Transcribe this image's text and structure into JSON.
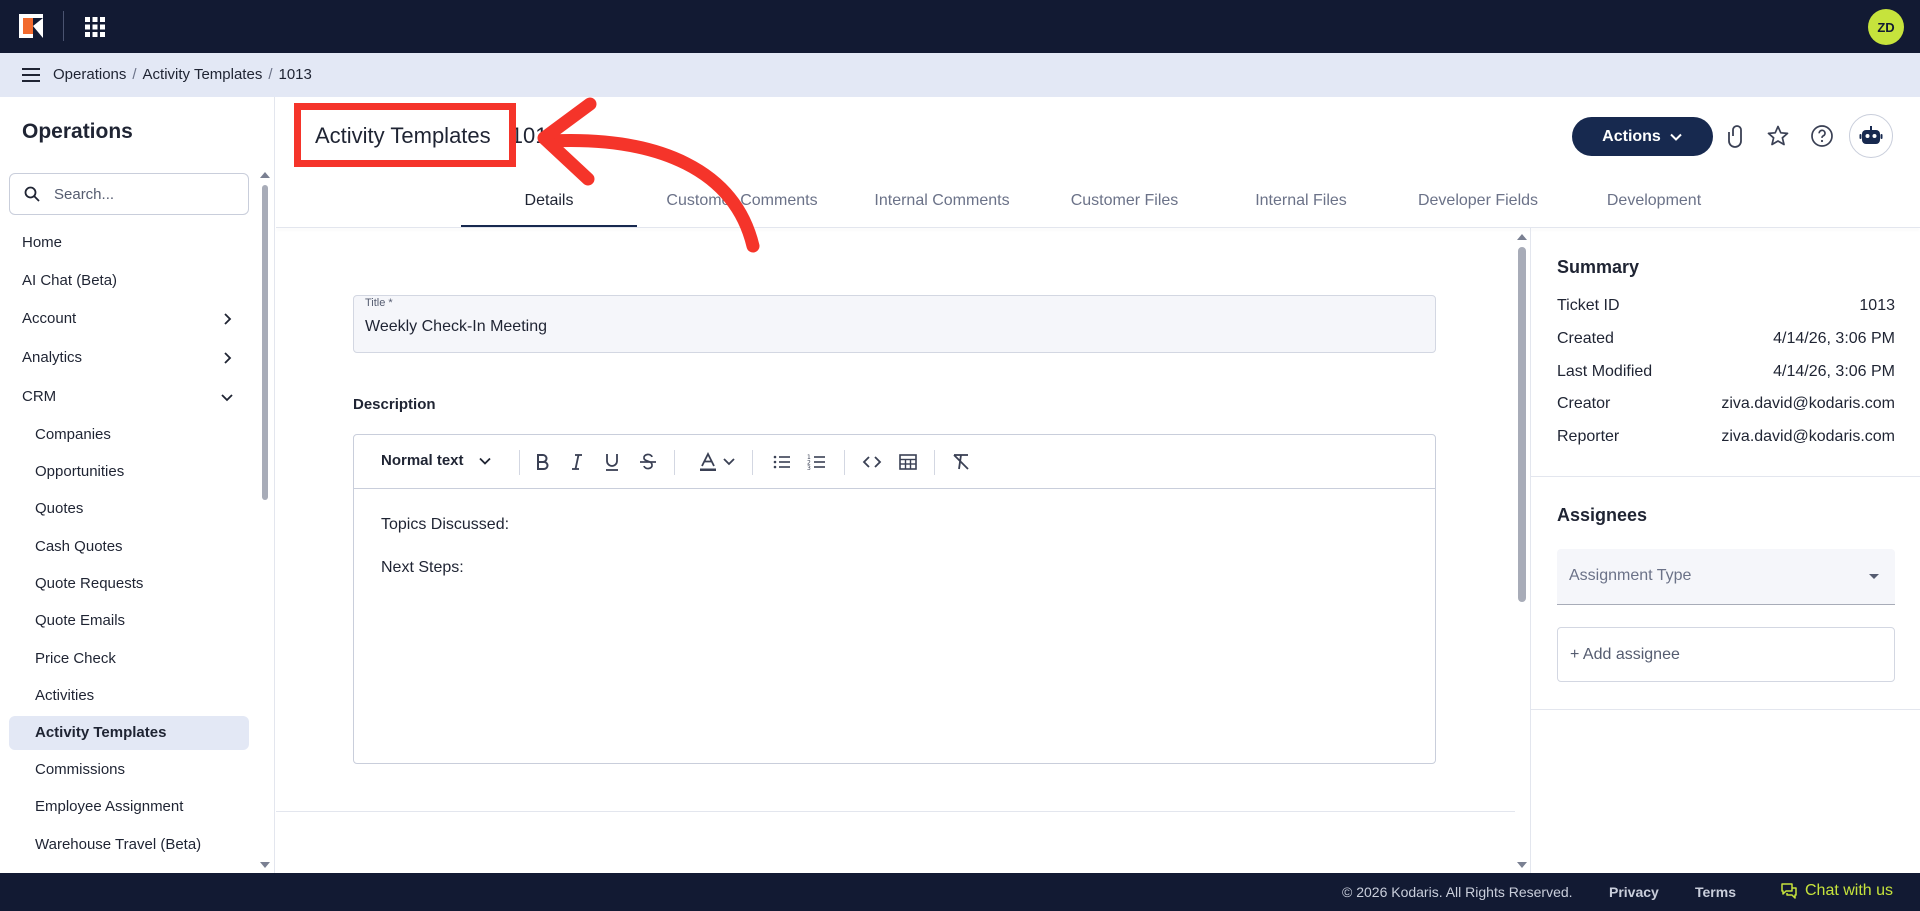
{
  "topbar": {
    "avatar_initials": "ZD"
  },
  "breadcrumb": {
    "items": [
      "Operations",
      "Activity Templates",
      "1013"
    ],
    "separator": "/"
  },
  "sidebar": {
    "title": "Operations",
    "search_placeholder": "Search...",
    "items": [
      {
        "label": "Home"
      },
      {
        "label": "AI Chat (Beta)"
      },
      {
        "label": "Account",
        "expandable": true,
        "expanded": false
      },
      {
        "label": "Analytics",
        "expandable": true,
        "expanded": false
      },
      {
        "label": "CRM",
        "expandable": true,
        "expanded": true
      }
    ],
    "crm_children": [
      "Companies",
      "Opportunities",
      "Quotes",
      "Cash Quotes",
      "Quote Requests",
      "Quote Emails",
      "Price Check",
      "Activities",
      "Activity Templates",
      "Commissions",
      "Employee Assignment",
      "Warehouse Travel (Beta)"
    ],
    "active_item": "Activity Templates"
  },
  "header": {
    "title": "Activity Templates",
    "record_id": "1013",
    "actions_label": "Actions",
    "icons": [
      "paperclip-icon",
      "star-icon",
      "help-icon",
      "bot-icon"
    ]
  },
  "tabs": [
    {
      "label": "Details",
      "active": true
    },
    {
      "label": "Customer Comments"
    },
    {
      "label": "Internal Comments"
    },
    {
      "label": "Customer Files"
    },
    {
      "label": "Internal Files"
    },
    {
      "label": "Developer Fields"
    },
    {
      "label": "Development"
    }
  ],
  "form": {
    "title_label": "Title *",
    "title_value": "Weekly Check-In Meeting",
    "description_label": "Description",
    "editor": {
      "block_style": "Normal text",
      "tools": [
        "bold-icon",
        "italic-icon",
        "underline-icon",
        "strikethrough-icon",
        "text-color-icon",
        "bullet-list-icon",
        "numbered-list-icon",
        "code-icon",
        "table-icon",
        "clear-format-icon"
      ],
      "content": [
        "Topics Discussed:",
        "Next Steps:"
      ]
    }
  },
  "summary": {
    "title": "Summary",
    "rows": [
      {
        "label": "Ticket ID",
        "value": "1013"
      },
      {
        "label": "Created",
        "value": "4/14/26, 3:06 PM"
      },
      {
        "label": "Last Modified",
        "value": "4/14/26, 3:06 PM"
      },
      {
        "label": "Creator",
        "value": "ziva.david@kodaris.com"
      },
      {
        "label": "Reporter",
        "value": "ziva.david@kodaris.com"
      }
    ]
  },
  "assignees": {
    "title": "Assignees",
    "type_placeholder": "Assignment Type",
    "add_label": "+ Add assignee"
  },
  "footer": {
    "copyright": "© 2026 Kodaris. All Rights Reserved.",
    "privacy": "Privacy",
    "terms": "Terms",
    "chat": "Chat with us"
  },
  "colors": {
    "navy": "#121a33",
    "accent_button": "#17294f",
    "lime": "#c6e33c",
    "annotation": "#f5342a",
    "active_bg": "#e3e8f5"
  }
}
